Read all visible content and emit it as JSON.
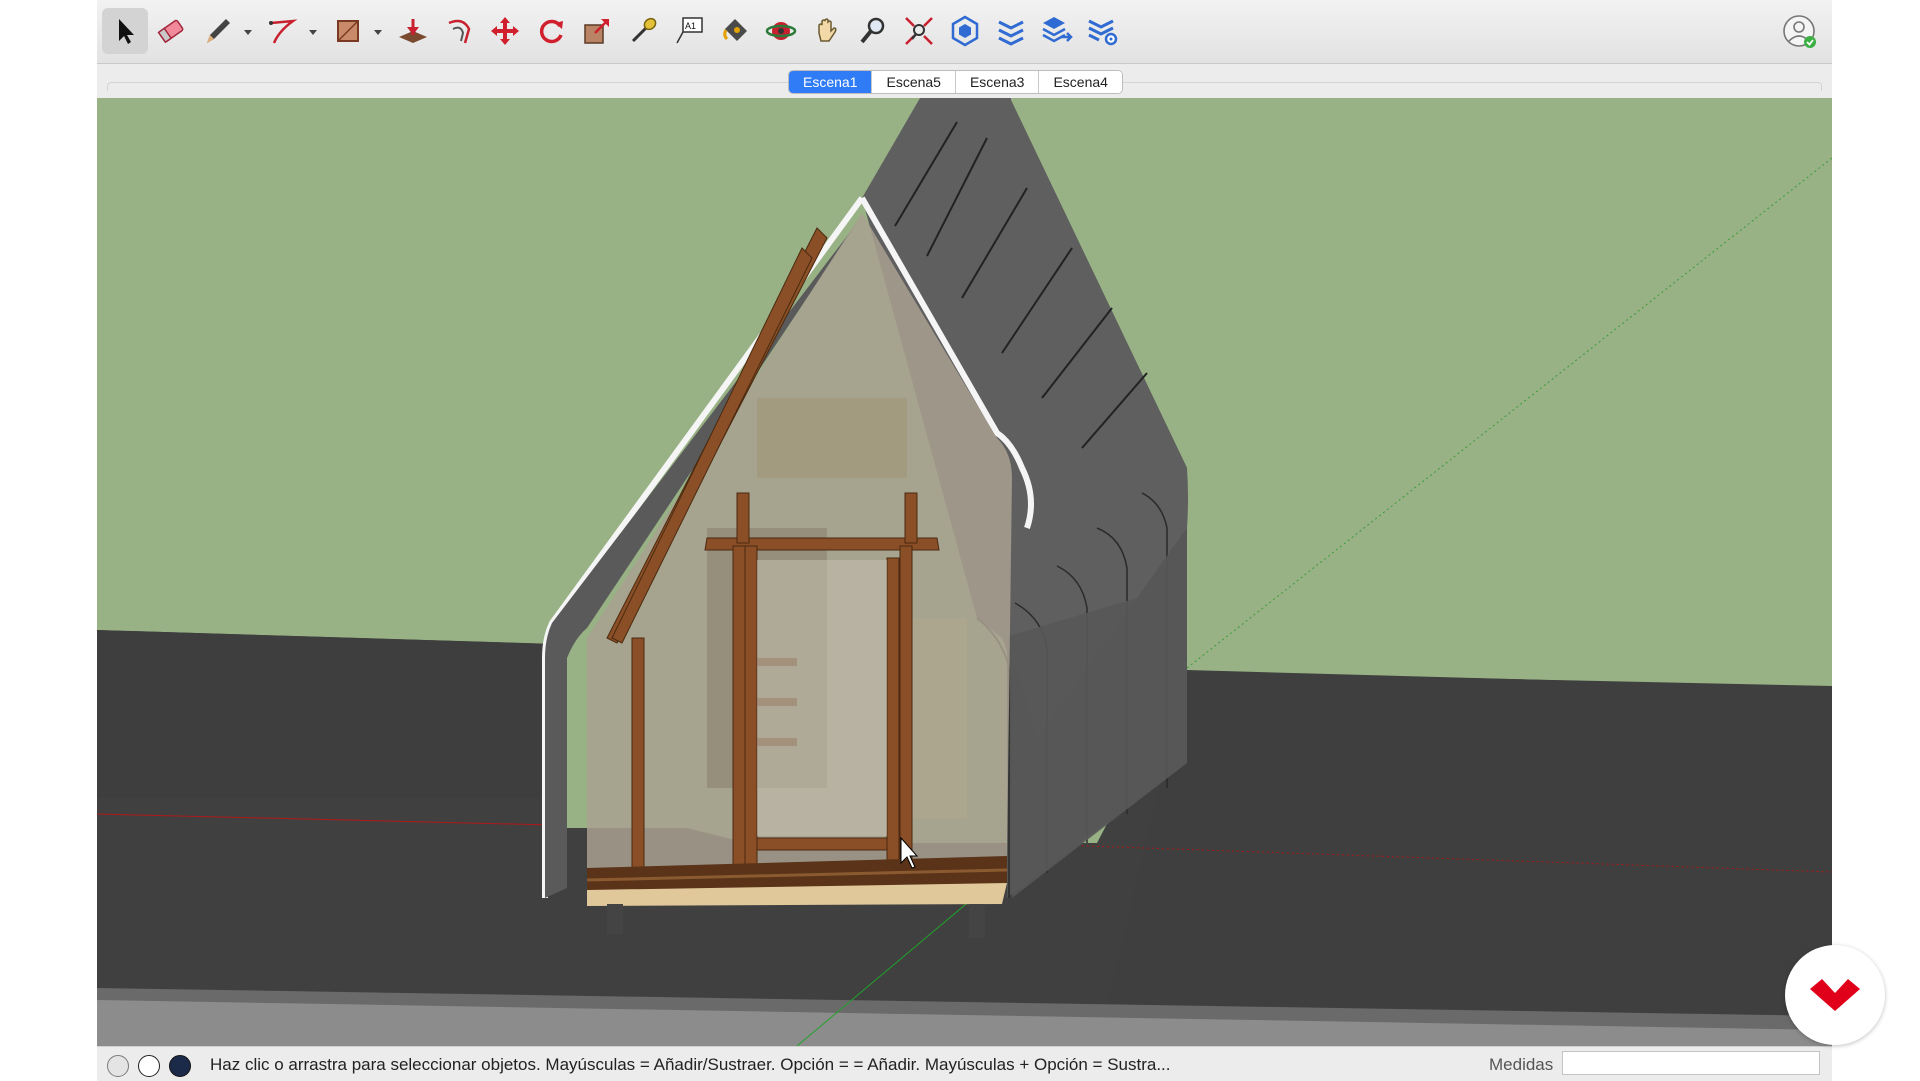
{
  "toolbar": {
    "tools": [
      {
        "name": "select-tool",
        "icon": "arrow-cursor-icon",
        "active": true
      },
      {
        "name": "eraser-tool",
        "icon": "eraser-icon"
      },
      {
        "name": "line-tool",
        "icon": "pencil-icon"
      },
      {
        "name": "arc-tool",
        "icon": "arc-icon"
      },
      {
        "name": "shape-tool",
        "icon": "rectangle-icon"
      },
      {
        "name": "push-pull-tool",
        "icon": "push-pull-icon"
      },
      {
        "name": "offset-tool",
        "icon": "offset-icon"
      },
      {
        "name": "move-tool",
        "icon": "move-arrows-icon"
      },
      {
        "name": "rotate-tool",
        "icon": "rotate-icon"
      },
      {
        "name": "scale-tool",
        "icon": "scale-icon"
      },
      {
        "name": "tape-measure-tool",
        "icon": "tape-measure-icon"
      },
      {
        "name": "text-tool",
        "icon": "text-label-icon"
      },
      {
        "name": "paint-bucket-tool",
        "icon": "paint-bucket-icon"
      },
      {
        "name": "orbit-tool",
        "icon": "orbit-icon"
      },
      {
        "name": "pan-tool",
        "icon": "hand-icon"
      },
      {
        "name": "zoom-tool",
        "icon": "magnifier-icon"
      },
      {
        "name": "zoom-extents-tool",
        "icon": "zoom-extents-icon"
      },
      {
        "name": "warehouse-tool",
        "icon": "3d-warehouse-icon"
      },
      {
        "name": "extension-warehouse-tool",
        "icon": "extension-warehouse-icon"
      },
      {
        "name": "layout-send-tool",
        "icon": "send-to-layout-icon"
      },
      {
        "name": "extension-manager-tool",
        "icon": "extension-manager-icon"
      }
    ],
    "text_tool_glyph": "A1"
  },
  "scenes": {
    "tabs": [
      "Escena1",
      "Escena5",
      "Escena3",
      "Escena4"
    ],
    "selected": "Escena1"
  },
  "statusbar": {
    "hint": "Haz clic o arrastra para seleccionar objetos. Mayúsculas = Añadir/Sustraer. Opción = = Añadir. Mayúsculas + Opción = Sustra...",
    "measure_label": "Medidas",
    "measure_value": ""
  },
  "colors": {
    "sky": "#98b285",
    "ground": "#404040",
    "roof": "#5e5e5e",
    "wood": "#8a4f26",
    "selected_tab": "#2f7cf6",
    "logo_red": "#e1001a"
  }
}
